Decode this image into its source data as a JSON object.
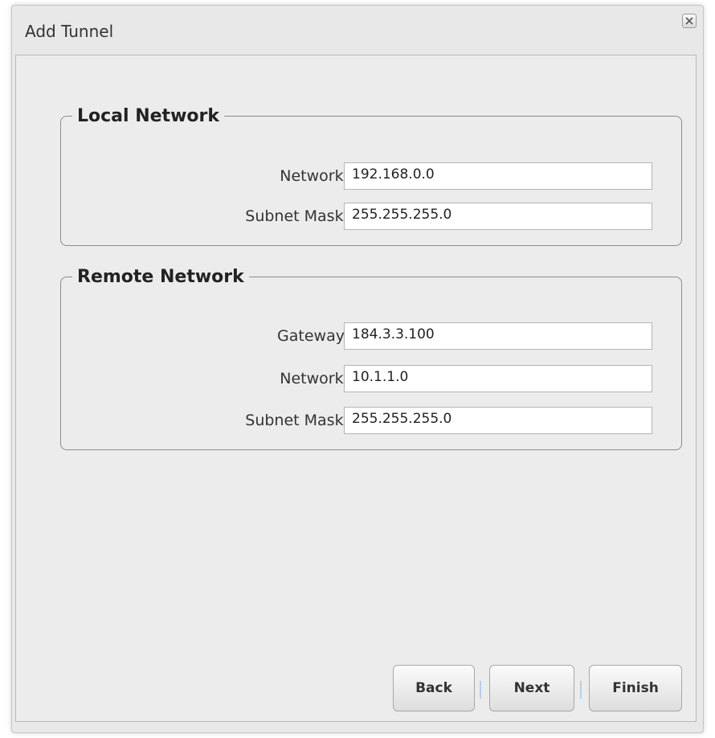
{
  "dialog": {
    "title": "Add Tunnel",
    "close_icon": "close-icon"
  },
  "local_network": {
    "legend": "Local Network",
    "fields": [
      {
        "label": "Network:",
        "value": "192.168.0.0"
      },
      {
        "label": "Subnet Mask:",
        "value": "255.255.255.0"
      }
    ]
  },
  "remote_network": {
    "legend": "Remote Network",
    "fields": [
      {
        "label": "Gateway:",
        "value": "184.3.3.100"
      },
      {
        "label": "Network:",
        "value": "10.1.1.0"
      },
      {
        "label": "Subnet Mask:",
        "value": "255.255.255.0"
      }
    ]
  },
  "buttons": {
    "back": "Back",
    "next": "Next",
    "finish": "Finish"
  },
  "colors": {
    "window_bg": "#e8e8e8",
    "separator": "#b7cfe6"
  }
}
